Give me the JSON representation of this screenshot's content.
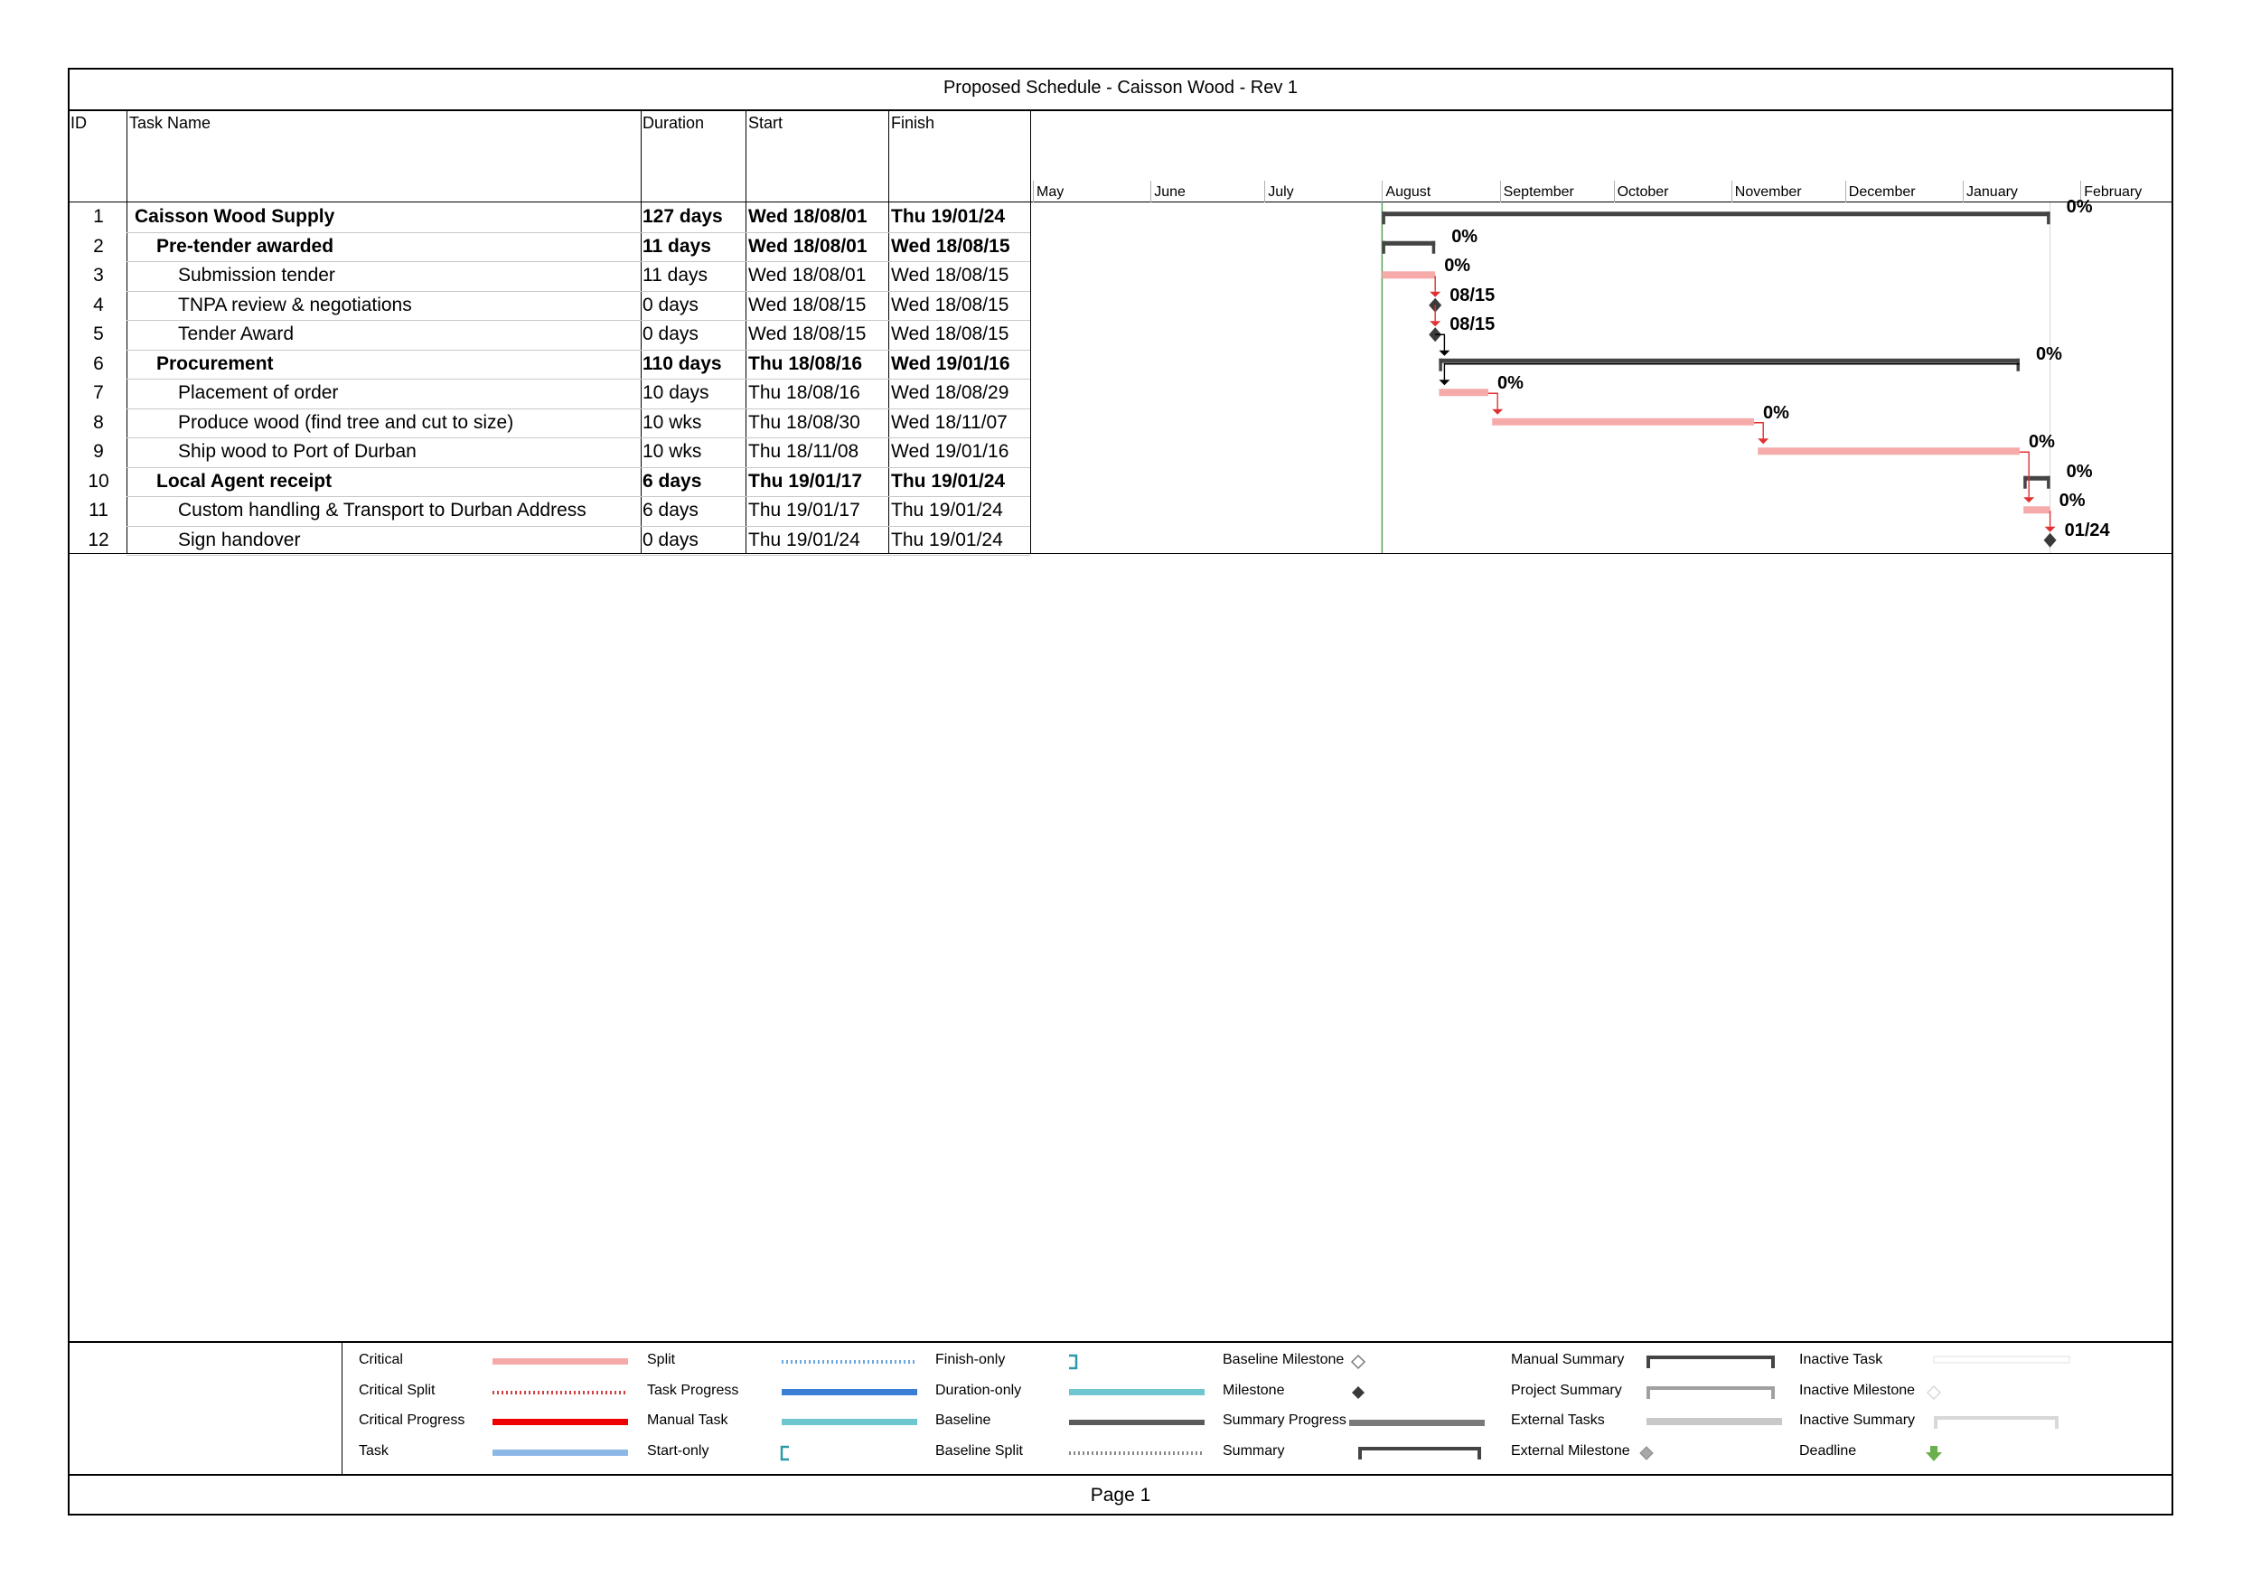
{
  "header": {
    "title": "Proposed Schedule - Caisson Wood - Rev 1"
  },
  "columns": {
    "id": "ID",
    "task_name": "Task Name",
    "duration": "Duration",
    "start": "Start",
    "finish": "Finish"
  },
  "timescale": {
    "months": [
      "May",
      "June",
      "July",
      "August",
      "September",
      "October",
      "November",
      "December",
      "January",
      "February"
    ]
  },
  "tasks": [
    {
      "id": "1",
      "name": "Caisson Wood Supply",
      "duration": "127 days",
      "start": "Wed 18/08/01",
      "finish": "Thu 19/01/24",
      "level": 0,
      "bold": true,
      "type": "summary",
      "label": "0%"
    },
    {
      "id": "2",
      "name": "Pre-tender awarded",
      "duration": "11 days",
      "start": "Wed 18/08/01",
      "finish": "Wed 18/08/15",
      "level": 1,
      "bold": true,
      "type": "summary",
      "label": "0%"
    },
    {
      "id": "3",
      "name": "Submission tender",
      "duration": "11 days",
      "start": "Wed 18/08/01",
      "finish": "Wed 18/08/15",
      "level": 2,
      "bold": false,
      "type": "critical",
      "label": "0%"
    },
    {
      "id": "4",
      "name": "TNPA review & negotiations",
      "duration": "0 days",
      "start": "Wed 18/08/15",
      "finish": "Wed 18/08/15",
      "level": 2,
      "bold": false,
      "type": "milestone",
      "label": "08/15"
    },
    {
      "id": "5",
      "name": "Tender Award",
      "duration": "0 days",
      "start": "Wed 18/08/15",
      "finish": "Wed 18/08/15",
      "level": 2,
      "bold": false,
      "type": "milestone",
      "label": "08/15"
    },
    {
      "id": "6",
      "name": "Procurement",
      "duration": "110 days",
      "start": "Thu 18/08/16",
      "finish": "Wed 19/01/16",
      "level": 1,
      "bold": true,
      "type": "summary",
      "label": "0%"
    },
    {
      "id": "7",
      "name": "Placement of order",
      "duration": "10 days",
      "start": "Thu 18/08/16",
      "finish": "Wed 18/08/29",
      "level": 2,
      "bold": false,
      "type": "critical",
      "label": "0%"
    },
    {
      "id": "8",
      "name": "Produce wood (find tree and cut to size)",
      "duration": "10 wks",
      "start": "Thu 18/08/30",
      "finish": "Wed 18/11/07",
      "level": 2,
      "bold": false,
      "type": "critical",
      "label": "0%"
    },
    {
      "id": "9",
      "name": "Ship wood to Port of Durban",
      "duration": "10 wks",
      "start": "Thu 18/11/08",
      "finish": "Wed 19/01/16",
      "level": 2,
      "bold": false,
      "type": "critical",
      "label": "0%"
    },
    {
      "id": "10",
      "name": "Local Agent receipt",
      "duration": "6 days",
      "start": "Thu 19/01/17",
      "finish": "Thu 19/01/24",
      "level": 1,
      "bold": true,
      "type": "summary",
      "label": "0%"
    },
    {
      "id": "11",
      "name": "Custom handling & Transport to Durban Address",
      "duration": "6 days",
      "start": "Thu 19/01/17",
      "finish": "Thu 19/01/24",
      "level": 2,
      "bold": false,
      "type": "critical",
      "label": "0%"
    },
    {
      "id": "12",
      "name": "Sign handover",
      "duration": "0 days",
      "start": "Thu 19/01/24",
      "finish": "Thu 19/01/24",
      "level": 2,
      "bold": false,
      "type": "milestone",
      "label": "01/24"
    }
  ],
  "chart_data": {
    "type": "gantt",
    "title": "Proposed Schedule - Caisson Wood - Rev 1",
    "x_axis": {
      "type": "date",
      "range": [
        "2018-05-01",
        "2019-02-28"
      ],
      "months": [
        "May",
        "June",
        "July",
        "August",
        "September",
        "October",
        "November",
        "December",
        "January",
        "February"
      ]
    },
    "project_start_line": "2018-08-01",
    "bars": [
      {
        "id": 1,
        "type": "summary",
        "start": "2018-08-01",
        "end": "2019-01-24",
        "label": "0%"
      },
      {
        "id": 2,
        "type": "summary",
        "start": "2018-08-01",
        "end": "2018-08-15",
        "label": "0%"
      },
      {
        "id": 3,
        "type": "critical",
        "start": "2018-08-01",
        "end": "2018-08-15",
        "label": "0%"
      },
      {
        "id": 4,
        "type": "milestone",
        "date": "2018-08-15",
        "label": "08/15"
      },
      {
        "id": 5,
        "type": "milestone",
        "date": "2018-08-15",
        "label": "08/15"
      },
      {
        "id": 6,
        "type": "summary",
        "start": "2018-08-16",
        "end": "2019-01-16",
        "label": "0%"
      },
      {
        "id": 7,
        "type": "critical",
        "start": "2018-08-16",
        "end": "2018-08-29",
        "label": "0%"
      },
      {
        "id": 8,
        "type": "critical",
        "start": "2018-08-30",
        "end": "2018-11-07",
        "label": "0%"
      },
      {
        "id": 9,
        "type": "critical",
        "start": "2018-11-08",
        "end": "2019-01-16",
        "label": "0%"
      },
      {
        "id": 10,
        "type": "summary",
        "start": "2019-01-17",
        "end": "2019-01-24",
        "label": "0%"
      },
      {
        "id": 11,
        "type": "critical",
        "start": "2019-01-17",
        "end": "2019-01-24",
        "label": "0%"
      },
      {
        "id": 12,
        "type": "milestone",
        "date": "2019-01-24",
        "label": "01/24"
      }
    ],
    "links": [
      [
        3,
        4
      ],
      [
        4,
        5
      ],
      [
        5,
        6
      ],
      [
        6,
        7
      ],
      [
        7,
        8
      ],
      [
        8,
        9
      ],
      [
        9,
        11
      ],
      [
        11,
        12
      ]
    ]
  },
  "legend": {
    "items": [
      {
        "label": "Critical",
        "swatch": "critical"
      },
      {
        "label": "Critical Split",
        "swatch": "critical-split"
      },
      {
        "label": "Critical Progress",
        "swatch": "critical-progress"
      },
      {
        "label": "Task",
        "swatch": "task"
      },
      {
        "label": "Split",
        "swatch": "split"
      },
      {
        "label": "Task Progress",
        "swatch": "task-progress"
      },
      {
        "label": "Manual Task",
        "swatch": "manual-task"
      },
      {
        "label": "Start-only",
        "swatch": "start-only"
      },
      {
        "label": "Finish-only",
        "swatch": "finish-only"
      },
      {
        "label": "Duration-only",
        "swatch": "duration-only"
      },
      {
        "label": "Baseline",
        "swatch": "baseline"
      },
      {
        "label": "Baseline Split",
        "swatch": "baseline-split"
      },
      {
        "label": "Baseline Milestone",
        "swatch": "baseline-milestone"
      },
      {
        "label": "Milestone",
        "swatch": "milestone"
      },
      {
        "label": "Summary Progress",
        "swatch": "summary-progress"
      },
      {
        "label": "Summary",
        "swatch": "summary"
      },
      {
        "label": "Manual Summary",
        "swatch": "manual-summary"
      },
      {
        "label": "Project Summary",
        "swatch": "project-summary"
      },
      {
        "label": "External Tasks",
        "swatch": "external-tasks"
      },
      {
        "label": "External Milestone",
        "swatch": "external-milestone"
      },
      {
        "label": "Inactive Task",
        "swatch": "inactive-task"
      },
      {
        "label": "Inactive Milestone",
        "swatch": "inactive-milestone"
      },
      {
        "label": "Inactive Summary",
        "swatch": "inactive-summary"
      },
      {
        "label": "Deadline",
        "swatch": "deadline"
      }
    ]
  },
  "colors": {
    "critical": "#f7aaaa",
    "critical_progress": "#ee0000",
    "task": "#8cb8e8",
    "task_progress": "#3a7fd5",
    "manual_task": "#6ec6d0",
    "summary": "#444444",
    "link_red": "#e03030",
    "project_line": "#5aa05a",
    "deadline": "#6ab04c"
  },
  "footer": {
    "page": "Page 1"
  }
}
